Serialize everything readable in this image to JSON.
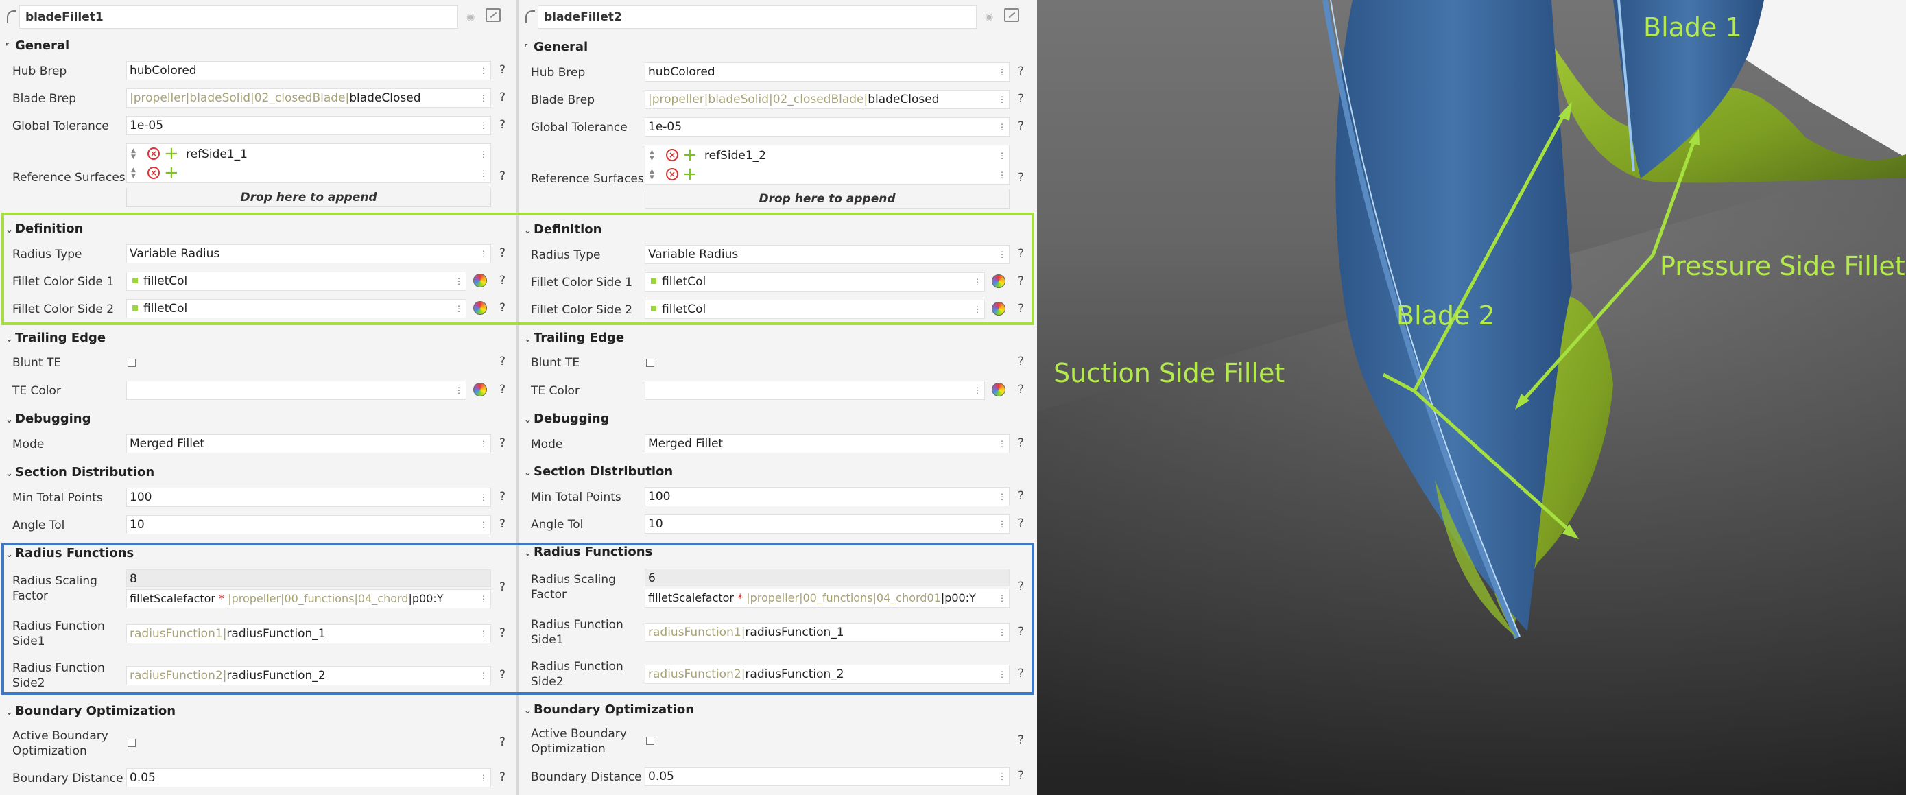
{
  "panels": [
    {
      "title": "bladeFillet1",
      "general": {
        "section": "General",
        "hub_brep_label": "Hub Brep",
        "hub_brep": "hubColored",
        "blade_brep_label": "Blade Brep",
        "blade_brep_path": "|propeller|bladeSolid|02_closedBlade|",
        "blade_brep": "bladeClosed",
        "global_tol_label": "Global Tolerance",
        "global_tol": "1e-05",
        "ref_surfaces_label": "Reference Surfaces",
        "ref_surface_1": "refSide1_1",
        "drop_text": "Drop here to append"
      },
      "definition": {
        "section": "Definition",
        "radius_type_label": "Radius Type",
        "radius_type": "Variable Radius",
        "color1_label": "Fillet Color Side 1",
        "color1": "filletCol",
        "color2_label": "Fillet Color Side 2",
        "color2": "filletCol"
      },
      "trailing": {
        "section": "Trailing Edge",
        "blunt_label": "Blunt TE",
        "te_color_label": "TE Color",
        "te_color": ""
      },
      "debugging": {
        "section": "Debugging",
        "mode_label": "Mode",
        "mode": "Merged Fillet"
      },
      "section_dist": {
        "section": "Section Distribution",
        "min_pts_label": "Min Total Points",
        "min_pts": "100",
        "angle_tol_label": "Angle Tol",
        "angle_tol": "10"
      },
      "radius": {
        "section": "Radius Functions",
        "scaling_label_1": "Radius Scaling",
        "scaling_label_2": "Factor",
        "scaling_value": "8",
        "scaling_expr": "filletScalefactor",
        "scaling_star": "*",
        "scaling_path": "|propeller|00_functions|04_chord",
        "scaling_tail": "|p00:Y",
        "side1_label_1": "Radius Function",
        "side1_label_2": "Side1",
        "side1_ref": "radiusFunction1",
        "side1_sep": "|",
        "side1": "radiusFunction_1",
        "side2_label_1": "Radius Function",
        "side2_label_2": "Side2",
        "side2_ref": "radiusFunction2",
        "side2_sep": "|",
        "side2": "radiusFunction_2"
      },
      "boundary": {
        "section": "Boundary Optimization",
        "active_label_1": "Active Boundary",
        "active_label_2": "Optimization",
        "distance_label": "Boundary Distance",
        "distance": "0.05"
      }
    },
    {
      "title": "bladeFillet2",
      "general": {
        "section": "General",
        "hub_brep_label": "Hub Brep",
        "hub_brep": "hubColored",
        "blade_brep_label": "Blade Brep",
        "blade_brep_path": "|propeller|bladeSolid|02_closedBlade|",
        "blade_brep": "bladeClosed",
        "global_tol_label": "Global Tolerance",
        "global_tol": "1e-05",
        "ref_surfaces_label": "Reference Surfaces",
        "ref_surface_1": "refSide1_2",
        "drop_text": "Drop here to append"
      },
      "definition": {
        "section": "Definition",
        "radius_type_label": "Radius Type",
        "radius_type": "Variable Radius",
        "color1_label": "Fillet Color Side 1",
        "color1": "filletCol",
        "color2_label": "Fillet Color Side 2",
        "color2": "filletCol"
      },
      "trailing": {
        "section": "Trailing Edge",
        "blunt_label": "Blunt TE",
        "te_color_label": "TE Color",
        "te_color": ""
      },
      "debugging": {
        "section": "Debugging",
        "mode_label": "Mode",
        "mode": "Merged Fillet"
      },
      "section_dist": {
        "section": "Section Distribution",
        "min_pts_label": "Min Total Points",
        "min_pts": "100",
        "angle_tol_label": "Angle Tol",
        "angle_tol": "10"
      },
      "radius": {
        "section": "Radius Functions",
        "scaling_label_1": "Radius Scaling",
        "scaling_label_2": "Factor",
        "scaling_value": "6",
        "scaling_expr": "filletScalefactor",
        "scaling_star": "*",
        "scaling_path": "|propeller|00_functions|04_chord01",
        "scaling_tail": "|p00:Y",
        "side1_label_1": "Radius Function",
        "side1_label_2": "Side1",
        "side1_ref": "radiusFunction1",
        "side1_sep": "|",
        "side1": "radiusFunction_1",
        "side2_label_1": "Radius Function",
        "side2_label_2": "Side2",
        "side2_ref": "radiusFunction2",
        "side2_sep": "|",
        "side2": "radiusFunction_2"
      },
      "boundary": {
        "section": "Boundary Optimization",
        "active_label_1": "Active Boundary",
        "active_label_2": "Optimization",
        "distance_label": "Boundary Distance",
        "distance": "0.05"
      }
    }
  ],
  "help_glyph": "?",
  "viewport": {
    "annotations": {
      "blade1": "Blade 1",
      "blade2": "Blade 2",
      "pressure": "Pressure Side Fillet",
      "suction": "Suction Side Fillet"
    },
    "colors": {
      "annotation": "#b5ea4f",
      "blade": "#3e6aa0",
      "fillet": "#8fb82a",
      "highlight_definition": "#a8dd43",
      "highlight_radius": "#3f78c5"
    }
  }
}
